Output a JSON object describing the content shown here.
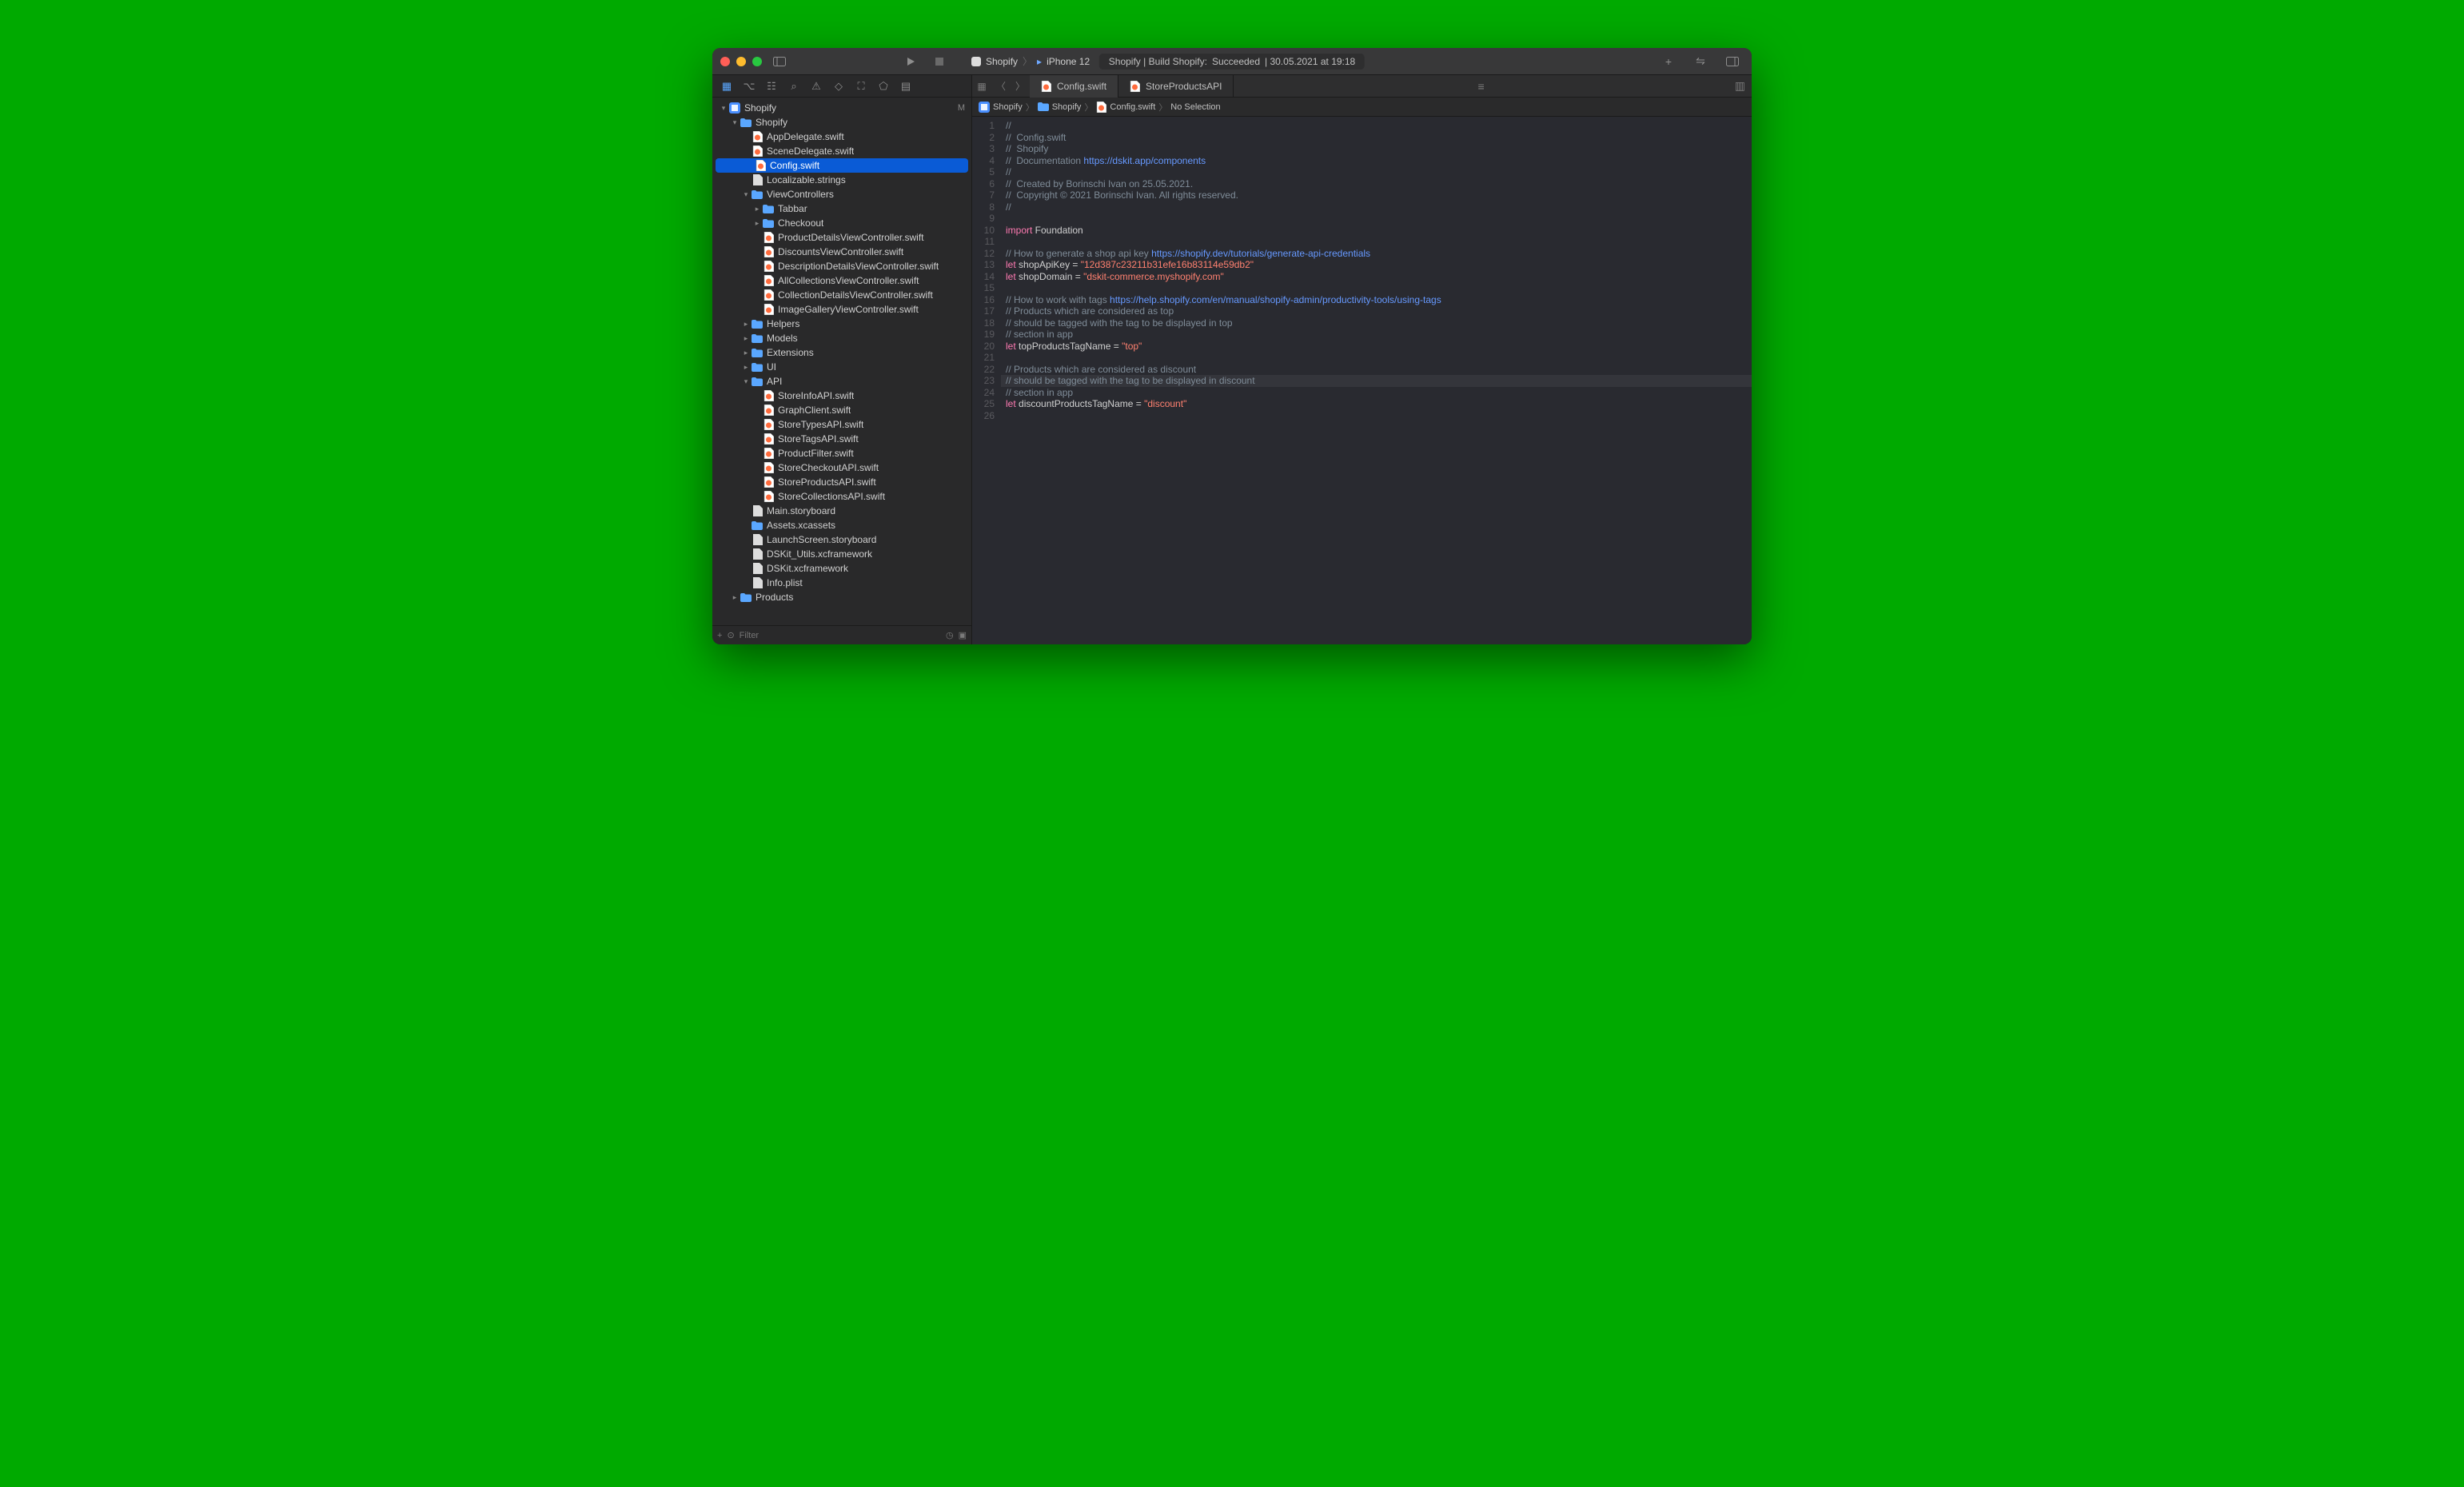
{
  "titlebar": {
    "scheme_target": "Shopify",
    "device": "iPhone 12",
    "status_prefix": "Shopify | Build Shopify: ",
    "status_result": "Succeeded",
    "status_time": " | 30.05.2021 at 19:18"
  },
  "sidebar": {
    "filter_placeholder": "Filter",
    "tree": [
      {
        "d": 0,
        "t": "proj",
        "e": 1,
        "lbl": "Shopify",
        "badge": "M"
      },
      {
        "d": 1,
        "t": "fld",
        "e": 1,
        "lbl": "Shopify"
      },
      {
        "d": 2,
        "t": "sw",
        "lbl": "AppDelegate.swift"
      },
      {
        "d": 2,
        "t": "sw",
        "lbl": "SceneDelegate.swift"
      },
      {
        "d": 2,
        "t": "sw",
        "lbl": "Config.swift",
        "sel": 1
      },
      {
        "d": 2,
        "t": "str",
        "lbl": "Localizable.strings"
      },
      {
        "d": 2,
        "t": "fld",
        "e": 1,
        "lbl": "ViewControllers"
      },
      {
        "d": 3,
        "t": "fld",
        "e": 0,
        "lbl": "Tabbar"
      },
      {
        "d": 3,
        "t": "fld",
        "e": 0,
        "lbl": "Checkoout"
      },
      {
        "d": 3,
        "t": "sw",
        "lbl": "ProductDetailsViewController.swift"
      },
      {
        "d": 3,
        "t": "sw",
        "lbl": "DiscountsViewController.swift"
      },
      {
        "d": 3,
        "t": "sw",
        "lbl": "DescriptionDetailsViewController.swift"
      },
      {
        "d": 3,
        "t": "sw",
        "lbl": "AllCollectionsViewController.swift"
      },
      {
        "d": 3,
        "t": "sw",
        "lbl": "CollectionDetailsViewController.swift"
      },
      {
        "d": 3,
        "t": "sw",
        "lbl": "ImageGalleryViewController.swift"
      },
      {
        "d": 2,
        "t": "fld",
        "e": 0,
        "lbl": "Helpers"
      },
      {
        "d": 2,
        "t": "fld",
        "e": 0,
        "lbl": "Models"
      },
      {
        "d": 2,
        "t": "fld",
        "e": 0,
        "lbl": "Extensions"
      },
      {
        "d": 2,
        "t": "fld",
        "e": 0,
        "lbl": "UI"
      },
      {
        "d": 2,
        "t": "fld",
        "e": 1,
        "lbl": "API"
      },
      {
        "d": 3,
        "t": "sw",
        "lbl": "StoreInfoAPI.swift"
      },
      {
        "d": 3,
        "t": "sw",
        "lbl": "GraphClient.swift"
      },
      {
        "d": 3,
        "t": "sw",
        "lbl": "StoreTypesAPI.swift"
      },
      {
        "d": 3,
        "t": "sw",
        "lbl": "StoreTagsAPI.swift"
      },
      {
        "d": 3,
        "t": "sw",
        "lbl": "ProductFilter.swift"
      },
      {
        "d": 3,
        "t": "sw",
        "lbl": "StoreCheckoutAPI.swift"
      },
      {
        "d": 3,
        "t": "sw",
        "lbl": "StoreProductsAPI.swift"
      },
      {
        "d": 3,
        "t": "sw",
        "lbl": "StoreCollectionsAPI.swift"
      },
      {
        "d": 2,
        "t": "sb",
        "lbl": "Main.storyboard"
      },
      {
        "d": 2,
        "t": "fld",
        "lbl": "Assets.xcassets"
      },
      {
        "d": 2,
        "t": "sb",
        "lbl": "LaunchScreen.storyboard"
      },
      {
        "d": 2,
        "t": "fw",
        "lbl": "DSKit_Utils.xcframework"
      },
      {
        "d": 2,
        "t": "fw",
        "lbl": "DSKit.xcframework"
      },
      {
        "d": 2,
        "t": "pl",
        "lbl": "Info.plist"
      },
      {
        "d": 1,
        "t": "fld",
        "e": 0,
        "lbl": "Products"
      }
    ]
  },
  "tabs": [
    {
      "lbl": "Config.swift",
      "act": 1,
      "ico": "sw"
    },
    {
      "lbl": "StoreProductsAPI",
      "act": 0,
      "ico": "sw"
    }
  ],
  "jumpbar": [
    "Shopify",
    "Shopify",
    "Config.swift",
    "No Selection"
  ],
  "code_lines": [
    {
      "n": 1,
      "seg": [
        [
          "//",
          "cmt"
        ]
      ]
    },
    {
      "n": 2,
      "seg": [
        [
          "//  Config.swift",
          "cmt"
        ]
      ]
    },
    {
      "n": 3,
      "seg": [
        [
          "//  Shopify",
          "cmt"
        ]
      ]
    },
    {
      "n": 4,
      "seg": [
        [
          "//  Documentation ",
          "cmt"
        ],
        [
          "https://dskit.app/components",
          "url"
        ]
      ]
    },
    {
      "n": 5,
      "seg": [
        [
          "//",
          "cmt"
        ]
      ]
    },
    {
      "n": 6,
      "seg": [
        [
          "//  Created by Borinschi Ivan on 25.05.2021.",
          "cmt"
        ]
      ]
    },
    {
      "n": 7,
      "seg": [
        [
          "//  Copyright © 2021 Borinschi Ivan. All rights reserved.",
          "cmt"
        ]
      ]
    },
    {
      "n": 8,
      "seg": [
        [
          "//",
          "cmt"
        ]
      ]
    },
    {
      "n": 9,
      "seg": []
    },
    {
      "n": 10,
      "seg": [
        [
          "import",
          "kw"
        ],
        [
          " Foundation",
          ""
        ]
      ]
    },
    {
      "n": 11,
      "seg": []
    },
    {
      "n": 12,
      "seg": [
        [
          "// How to generate a shop api key ",
          "cmt"
        ],
        [
          "https://shopify.dev/tutorials/generate-api-credentials",
          "url"
        ]
      ]
    },
    {
      "n": 13,
      "seg": [
        [
          "let",
          "kw"
        ],
        [
          " shopApiKey = ",
          ""
        ],
        [
          "\"12d387c23211b31efe16b83114e59db2\"",
          "str"
        ]
      ]
    },
    {
      "n": 14,
      "seg": [
        [
          "let",
          "kw"
        ],
        [
          " shopDomain = ",
          ""
        ],
        [
          "\"dskit-commerce.myshopify.com\"",
          "str"
        ]
      ]
    },
    {
      "n": 15,
      "seg": []
    },
    {
      "n": 16,
      "seg": [
        [
          "// How to work with tags ",
          "cmt"
        ],
        [
          "https://help.shopify.com/en/manual/shopify-admin/productivity-tools/using-tags",
          "url"
        ]
      ]
    },
    {
      "n": 17,
      "seg": [
        [
          "// Products which are considered as top",
          "cmt"
        ]
      ]
    },
    {
      "n": 18,
      "seg": [
        [
          "// should be tagged with the tag to be displayed in top",
          "cmt"
        ]
      ]
    },
    {
      "n": 19,
      "seg": [
        [
          "// section in app",
          "cmt"
        ]
      ]
    },
    {
      "n": 20,
      "seg": [
        [
          "let",
          "kw"
        ],
        [
          " topProductsTagName = ",
          ""
        ],
        [
          "\"top\"",
          "str"
        ]
      ]
    },
    {
      "n": 21,
      "seg": []
    },
    {
      "n": 22,
      "seg": [
        [
          "// Products which are considered as discount",
          "cmt"
        ]
      ]
    },
    {
      "n": 23,
      "cur": 1,
      "seg": [
        [
          "// should be tagged with the tag to be displayed in discount",
          "cmt"
        ]
      ]
    },
    {
      "n": 24,
      "seg": [
        [
          "// section in app",
          "cmt"
        ]
      ]
    },
    {
      "n": 25,
      "seg": [
        [
          "let",
          "kw"
        ],
        [
          " discountProductsTagName = ",
          ""
        ],
        [
          "\"discount\"",
          "str"
        ]
      ]
    },
    {
      "n": 26,
      "seg": []
    }
  ]
}
